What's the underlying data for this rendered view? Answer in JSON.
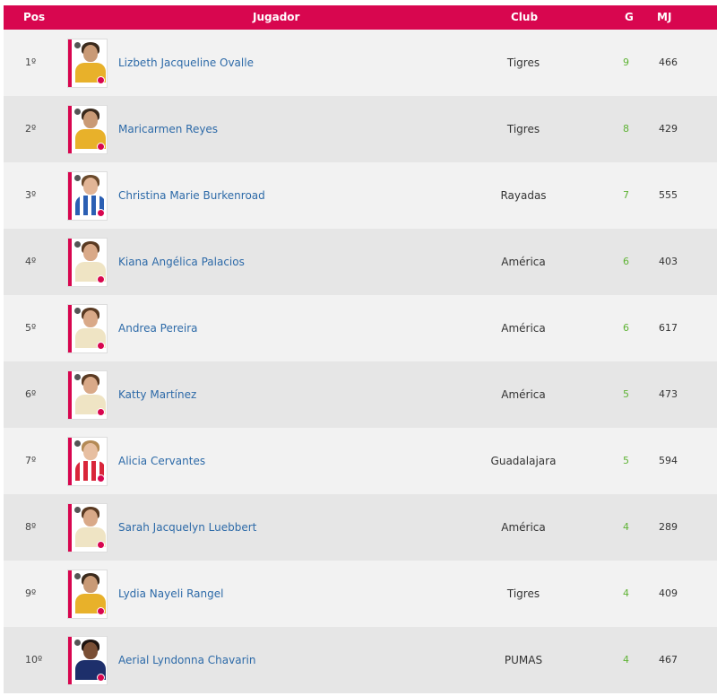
{
  "table": {
    "headers": {
      "pos": "Pos",
      "player": "Jugador",
      "club": "Club",
      "goals": "G",
      "matches": "MJ"
    },
    "rows": [
      {
        "pos": "1º",
        "name": "Lizbeth Jacqueline Ovalle",
        "club": "Tigres",
        "goals": "9",
        "mj": "466",
        "kit": "yellow"
      },
      {
        "pos": "2º",
        "name": "Maricarmen Reyes",
        "club": "Tigres",
        "goals": "8",
        "mj": "429",
        "kit": "yellow"
      },
      {
        "pos": "3º",
        "name": "Christina Marie Burkenroad",
        "club": "Rayadas",
        "goals": "7",
        "mj": "555",
        "kit": "blue-white-stripes"
      },
      {
        "pos": "4º",
        "name": "Kiana Angélica Palacios",
        "club": "América",
        "goals": "6",
        "mj": "403",
        "kit": "cream"
      },
      {
        "pos": "5º",
        "name": "Andrea Pereira",
        "club": "América",
        "goals": "6",
        "mj": "617",
        "kit": "cream"
      },
      {
        "pos": "6º",
        "name": "Katty Martínez",
        "club": "América",
        "goals": "5",
        "mj": "473",
        "kit": "cream"
      },
      {
        "pos": "7º",
        "name": "Alicia Cervantes",
        "club": "Guadalajara",
        "goals": "5",
        "mj": "594",
        "kit": "red-white-stripes"
      },
      {
        "pos": "8º",
        "name": "Sarah Jacquelyn Luebbert",
        "club": "América",
        "goals": "4",
        "mj": "289",
        "kit": "cream"
      },
      {
        "pos": "9º",
        "name": "Lydia Nayeli Rangel",
        "club": "Tigres",
        "goals": "4",
        "mj": "409",
        "kit": "yellow"
      },
      {
        "pos": "10º",
        "name": "Aerial Lyndonna Chavarin",
        "club": "PUMAS",
        "goals": "4",
        "mj": "467",
        "kit": "navy"
      }
    ]
  },
  "colors": {
    "header_bg": "#d8064f",
    "name_link": "#2d6aa8",
    "goals": "#5fb335"
  }
}
